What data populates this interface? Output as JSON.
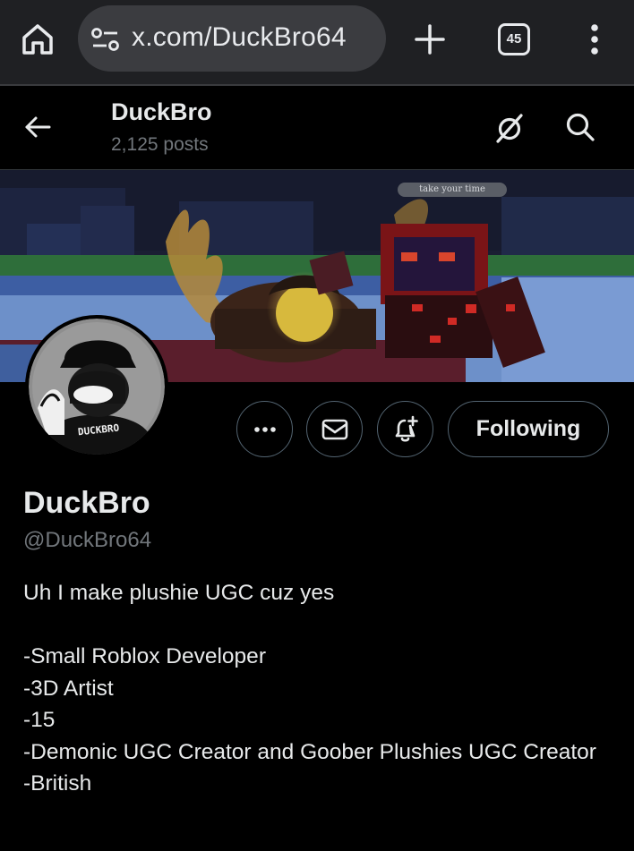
{
  "browser": {
    "url": "x.com/DuckBro64",
    "tab_count": "45"
  },
  "header": {
    "name": "DuckBro",
    "posts": "2,125 posts"
  },
  "banner": {
    "caption": "take your time"
  },
  "avatar": {
    "shirt_text": "DUCKBRO"
  },
  "actions": {
    "following_label": "Following"
  },
  "profile": {
    "display_name": "DuckBro",
    "handle": "@DuckBro64",
    "bio": [
      "Uh I make plushie UGC cuz yes",
      "",
      "-Small Roblox Developer",
      "-3D Artist",
      "-15",
      "-Demonic UGC Creator and Goober Plushies UGC Creator",
      "-British"
    ]
  },
  "colors": {
    "background": "#000000",
    "chrome": "#1f2023",
    "text_primary": "#e7e9ea",
    "text_secondary": "#71767b",
    "border": "#536471"
  }
}
